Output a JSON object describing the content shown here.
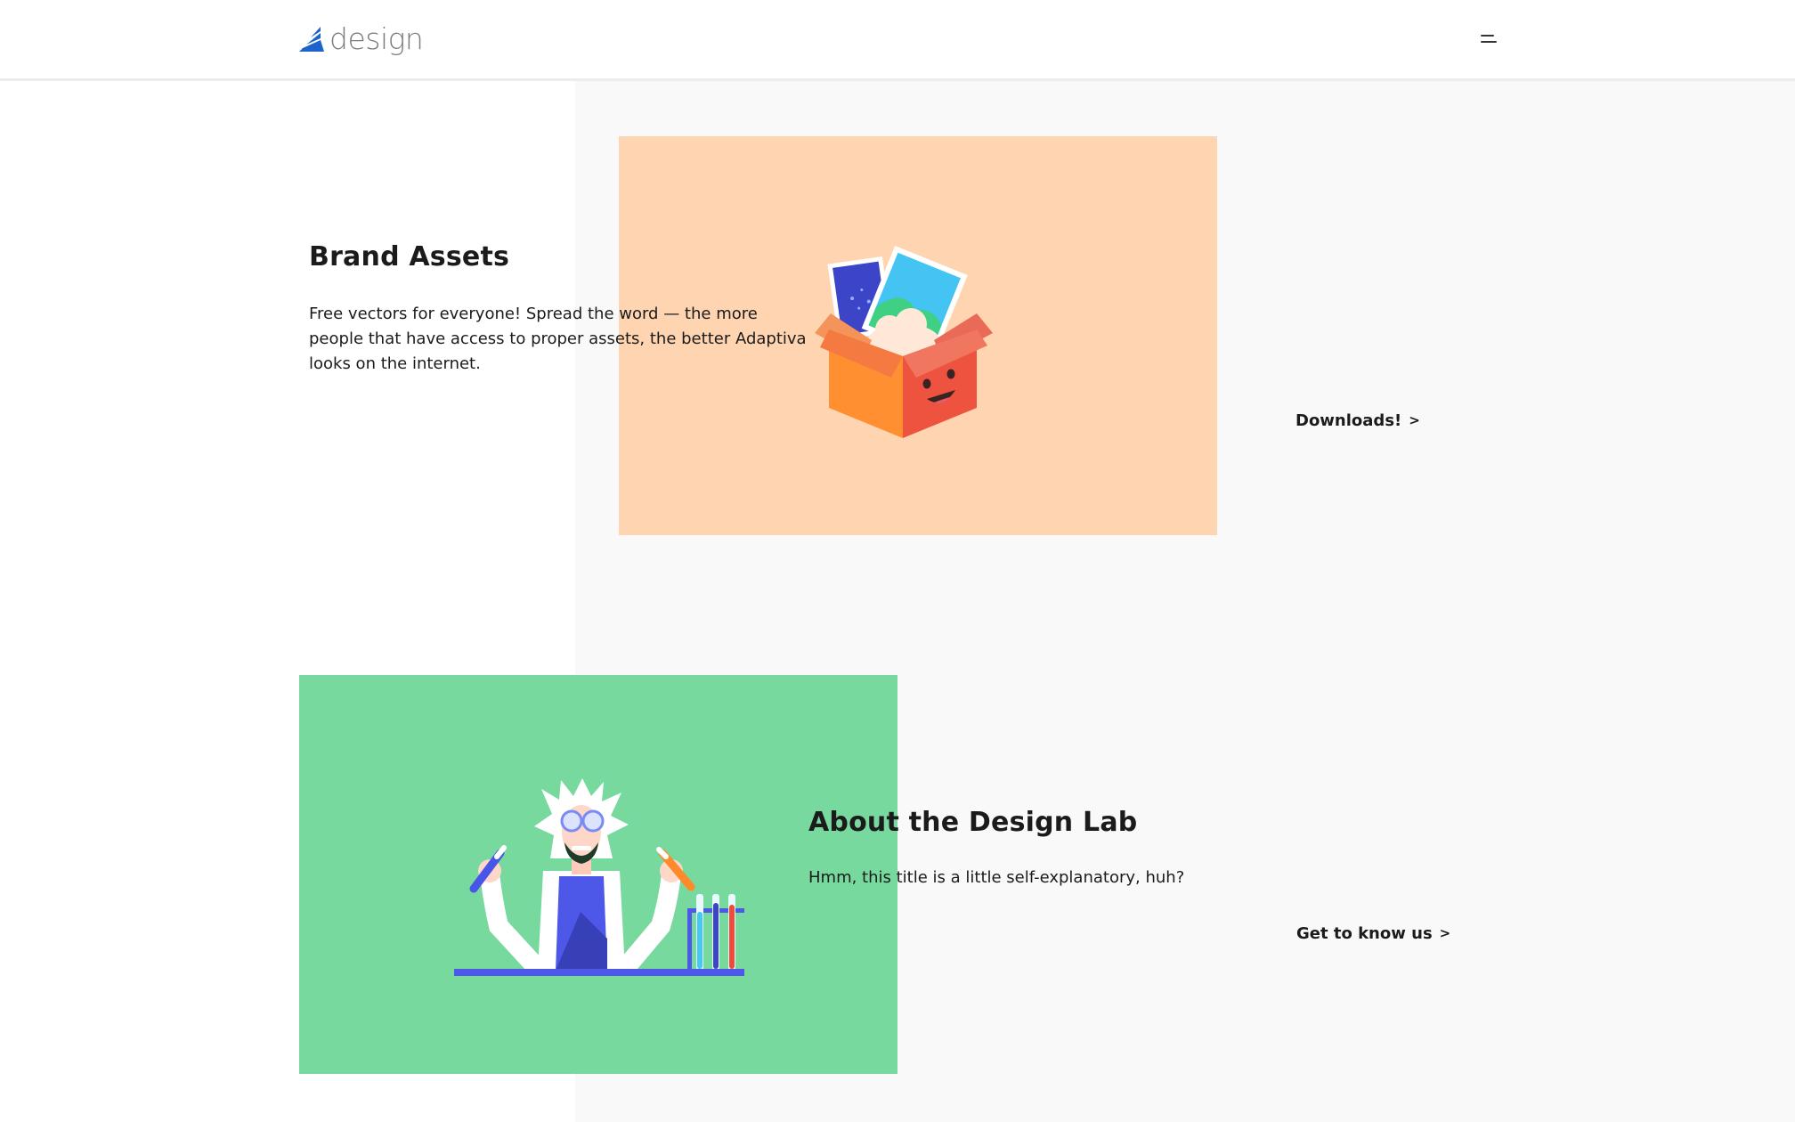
{
  "header": {
    "logo_text": "design",
    "brand_color": "#1e63c9",
    "menu_icon": "hamburger-menu-icon"
  },
  "sections": [
    {
      "title": "Brand Assets",
      "description": "Free vectors for everyone! Spread the word — the more people that have access to proper assets, the better Adaptiva looks on the internet.",
      "cta_label": "Downloads!",
      "cta_icon": "chevron-right-icon",
      "illustration": "open-box-with-pictures-illustration",
      "card_color": "#ffd4b0"
    },
    {
      "title": "About the Design Lab",
      "description": "Hmm, this title is a little self-explanatory, huh?",
      "cta_label": "Get to know us",
      "cta_icon": "chevron-right-icon",
      "illustration": "scientist-with-test-tubes-illustration",
      "card_color": "#77d99e"
    }
  ],
  "colors": {
    "page_background": "#ffffff",
    "panel_background": "#f9f9f9",
    "text": "#1b1b1b"
  }
}
